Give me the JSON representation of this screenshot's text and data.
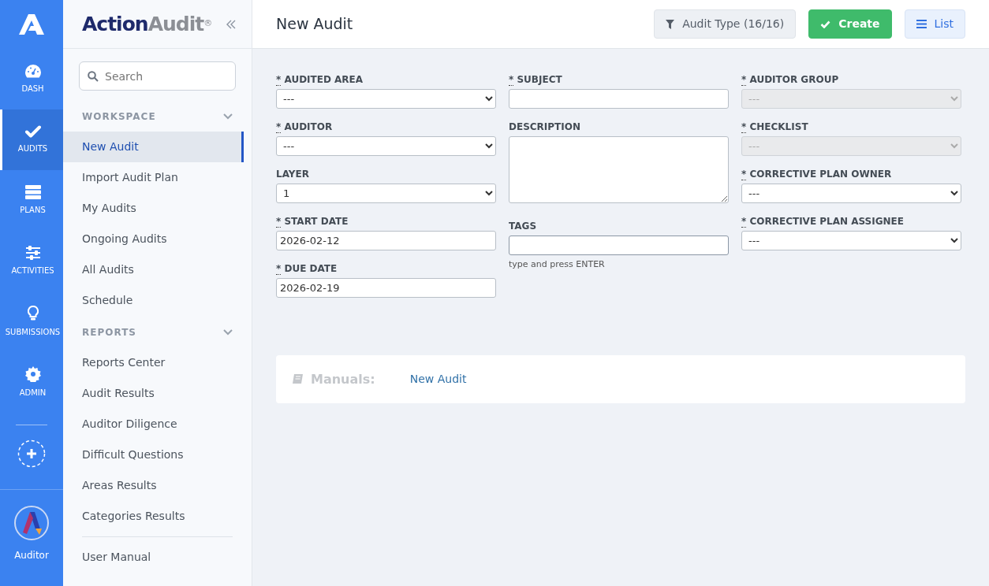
{
  "rail": {
    "items": [
      {
        "label": "DASH",
        "selected": false
      },
      {
        "label": "AUDITS",
        "selected": true
      },
      {
        "label": "PLANS",
        "selected": false
      },
      {
        "label": "ACTIVITIES",
        "selected": false
      },
      {
        "label": "SUBMISSIONS",
        "selected": false
      },
      {
        "label": "ADMIN",
        "selected": false
      }
    ],
    "user": {
      "label": "Auditor"
    }
  },
  "sidebar": {
    "brand": {
      "first": "Action",
      "second": "Audit",
      "mark": "®"
    },
    "search": {
      "placeholder": "Search"
    },
    "sections": [
      {
        "title": "WORKSPACE",
        "expanded": true,
        "items": [
          {
            "label": "New Audit",
            "selected": true
          },
          {
            "label": "Import Audit Plan",
            "selected": false
          },
          {
            "label": "My Audits",
            "selected": false
          },
          {
            "label": "Ongoing Audits",
            "selected": false
          },
          {
            "label": "All Audits",
            "selected": false
          },
          {
            "label": "Schedule",
            "selected": false
          }
        ]
      },
      {
        "title": "REPORTS",
        "expanded": true,
        "items": [
          {
            "label": "Reports Center",
            "selected": false
          },
          {
            "label": "Audit Results",
            "selected": false
          },
          {
            "label": "Auditor Diligence",
            "selected": false
          },
          {
            "label": "Difficult Questions",
            "selected": false
          },
          {
            "label": "Areas Results",
            "selected": false
          },
          {
            "label": "Categories Results",
            "selected": false
          }
        ]
      }
    ],
    "footer_items": [
      {
        "label": "User Manual",
        "selected": false
      }
    ]
  },
  "header": {
    "title": "New Audit",
    "buttons": [
      {
        "label": "Audit Type (16/16)",
        "kind": "filter"
      },
      {
        "label": "Create",
        "kind": "create"
      },
      {
        "label": "List",
        "kind": "list"
      }
    ]
  },
  "form": {
    "columns": [
      [
        {
          "mark": "*",
          "label": "AUDITED AREA",
          "kind": "select",
          "value": "---",
          "disabled": false
        },
        {
          "mark": "*",
          "label": "AUDITOR",
          "kind": "select",
          "value": "---",
          "disabled": false
        },
        {
          "label": "LAYER",
          "kind": "select",
          "value": "1",
          "disabled": false
        },
        {
          "mark": "*",
          "label": "START DATE",
          "kind": "input",
          "value": "2026-02-12"
        },
        {
          "mark": "*",
          "label": "DUE DATE",
          "kind": "input",
          "value": "2026-02-19"
        }
      ],
      [
        {
          "mark": "*",
          "label": "SUBJECT",
          "kind": "input"
        },
        {
          "label": "DESCRIPTION",
          "kind": "textarea"
        },
        {
          "label": "TAGS",
          "kind": "tags",
          "hint": "type and press ENTER"
        }
      ],
      [
        {
          "mark": "*",
          "label": "AUDITOR GROUP",
          "kind": "select",
          "value": "---",
          "disabled": true
        },
        {
          "mark": "*",
          "label": "CHECKLIST",
          "kind": "select",
          "value": "---",
          "disabled": true
        },
        {
          "mark": "*",
          "label": "CORRECTIVE PLAN OWNER",
          "kind": "select",
          "value": "---",
          "disabled": false
        },
        {
          "mark": "*",
          "label": "CORRECTIVE PLAN ASSIGNEE",
          "kind": "select",
          "value": "---",
          "disabled": false
        }
      ]
    ]
  },
  "manuals": {
    "label": "Manuals:",
    "links": [
      "New Audit"
    ]
  }
}
